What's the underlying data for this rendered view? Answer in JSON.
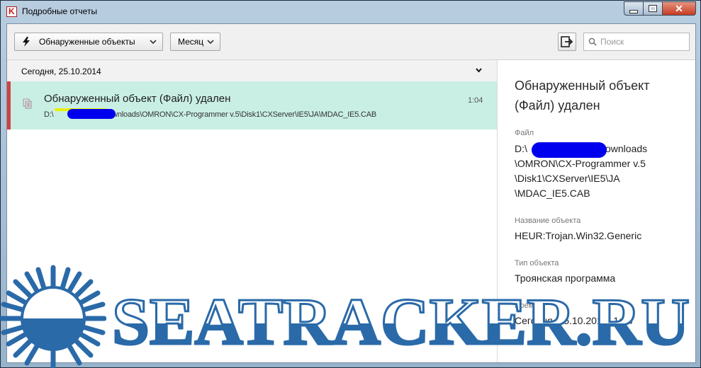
{
  "window": {
    "title": "Подробные отчеты",
    "controls": {
      "close_glyph": "✕"
    }
  },
  "toolbar": {
    "filter_detected": "Обнаруженные объекты",
    "filter_period": "Месяц",
    "search_placeholder": "Поиск",
    "icons": {
      "filter": "lightning-icon",
      "export": "export-icon",
      "search": "magnifier-icon"
    }
  },
  "list": {
    "group_date": "Сегодня, 25.10.2014",
    "events": [
      {
        "title": "Обнаруженный объект (Файл) удален",
        "path_prefix": "D:\\",
        "path_rest": "Downloads\\OMRON\\CX-Programmer v.5\\Disk1\\CXServer\\IE5\\JA\\MDAC_IE5.CAB",
        "time": "1:04"
      }
    ]
  },
  "details": {
    "title": "Обнаруженный объект (Файл) удален",
    "file_label": "Файл",
    "file_line1_prefix": "D:\\",
    "file_line1_rest": "Downloads",
    "file_line2": "\\OMRON\\CX-Programmer v.5",
    "file_line3": "\\Disk1\\CXServer\\IE5\\JA",
    "file_line4": "\\MDAC_IE5.CAB",
    "name_label": "Название объекта",
    "name_value": "HEUR:Trojan.Win32.Generic",
    "type_label": "Тип объекта",
    "type_value": "Троянская программа",
    "time_label": "Время",
    "time_value": "Сегодня, 25.10.2014, 1:04"
  },
  "watermark": {
    "text": "SEATRACKER.RU"
  },
  "colors": {
    "selected_row": "#c9efe4",
    "row_marker": "#d24141",
    "redaction": "#0000ee",
    "watermark_blue": "#2a6aa8"
  }
}
